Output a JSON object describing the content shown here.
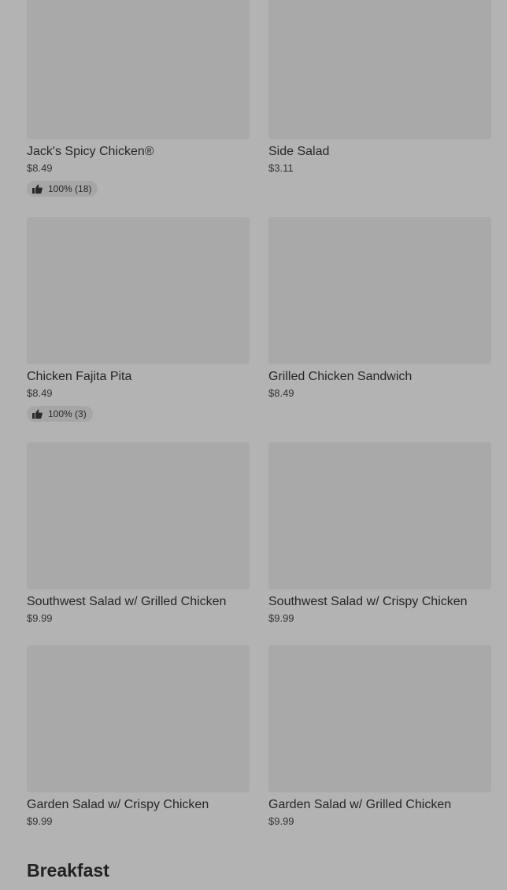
{
  "menu_items": [
    {
      "name": "Jack's Spicy Chicken®",
      "price": "$8.49",
      "rating": "100% (18)"
    },
    {
      "name": "Side Salad",
      "price": "$3.11"
    },
    {
      "name": "Chicken Fajita Pita",
      "price": "$8.49",
      "rating": "100% (3)"
    },
    {
      "name": "Grilled Chicken Sandwich",
      "price": "$8.49"
    },
    {
      "name": "Southwest Salad w/ Grilled Chicken",
      "price": "$9.99"
    },
    {
      "name": "Southwest Salad w/ Crispy Chicken",
      "price": "$9.99"
    },
    {
      "name": "Garden Salad w/ Crispy Chicken",
      "price": "$9.99"
    },
    {
      "name": "Garden Salad w/ Grilled Chicken",
      "price": "$9.99"
    }
  ],
  "next_section": {
    "title": "Breakfast"
  },
  "icons": {
    "rating": "thumbs-up-icon"
  }
}
